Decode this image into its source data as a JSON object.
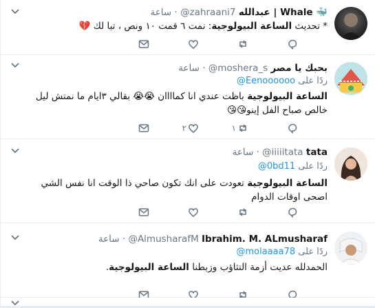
{
  "tweets": [
    {
      "name": "عبدالله | Whale 🐳",
      "handle": "@zahraani7",
      "time": "ساعة",
      "text_prefix": "* تحديث ",
      "text_bold": "الساعة البيولوجية",
      "text_rest": ": نمت ٦ قمت ١٠ ونص ، تبا لك 💔",
      "reply_count": "",
      "retweet_count": "",
      "like_count": ""
    },
    {
      "name": "بحبك يا مصر",
      "handle": "@moshera_s",
      "time": "ساعة",
      "reply_label": "ردًا على",
      "reply_handle": "@Eenoooooo",
      "text_bold": "الساعة البيولوجية",
      "text_rest": " باظت عندي انا كماااان 😭😭 بقالي ٣ايام ما نمتش ليل خالص صباح الفل إينو😘😘",
      "reply_count": "",
      "retweet_count": "١",
      "like_count": "٢"
    },
    {
      "name": "tata",
      "handle": "@iiiiitata",
      "time": "ساعة",
      "reply_label": "ردًا على",
      "reply_handle": "@0bd11",
      "text_bold": "الساعة البيولوجية",
      "text_rest": " تعودت على انك تكون صاحي ذا الوقت انا نفس الشي اصحى اوقات الدوام",
      "reply_count": "",
      "retweet_count": "",
      "like_count": ""
    },
    {
      "name": "Ibrahim. M. ALmusharaf",
      "handle": "@AlmusharafM",
      "time": "ساعة",
      "reply_label": "ردًا على",
      "reply_handle": "@molaaaa78",
      "text_prefix": "الحمدلله عديت أزمة التثاؤب وزبطنا ",
      "text_bold": "الساعة البيولوجية",
      "text_rest": ".",
      "reply_count": "",
      "retweet_count": "",
      "like_count": ""
    }
  ]
}
